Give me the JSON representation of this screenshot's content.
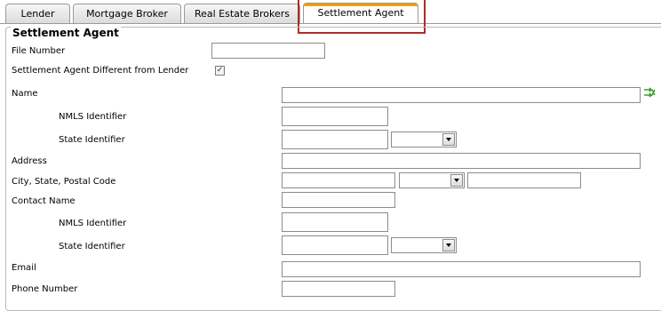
{
  "tabs": [
    {
      "label": "Lender",
      "active": false
    },
    {
      "label": "Mortgage Broker",
      "active": false
    },
    {
      "label": "Real Estate Brokers",
      "active": false
    },
    {
      "label": "Settlement Agent",
      "active": true
    }
  ],
  "section": {
    "title": "Settlement Agent"
  },
  "fields": {
    "file_number": {
      "label": "File Number",
      "value": ""
    },
    "different_from_lender": {
      "label": "Settlement Agent Different from Lender",
      "checked": true,
      "glyph": "✓"
    },
    "name": {
      "label": "Name",
      "value": ""
    },
    "nmls_1": {
      "label": "NMLS Identifier",
      "value": ""
    },
    "state_id_1": {
      "label": "State Identifier",
      "value": "",
      "select_value": ""
    },
    "address": {
      "label": "Address",
      "value": ""
    },
    "city_state_zip": {
      "label": "City, State, Postal Code",
      "city": "",
      "state": "",
      "zip": ""
    },
    "contact_name": {
      "label": "Contact Name",
      "value": ""
    },
    "nmls_2": {
      "label": "NMLS Identifier",
      "value": ""
    },
    "state_id_2": {
      "label": "State Identifier",
      "value": "",
      "select_value": ""
    },
    "email": {
      "label": "Email",
      "value": ""
    },
    "phone": {
      "label": "Phone Number",
      "value": ""
    }
  },
  "icons": {
    "name_action": "swap-arrows-icon"
  },
  "colors": {
    "active_tab_accent": "#f0a000",
    "highlight": "#b02a2a",
    "icon_green": "#3c9a2e"
  }
}
